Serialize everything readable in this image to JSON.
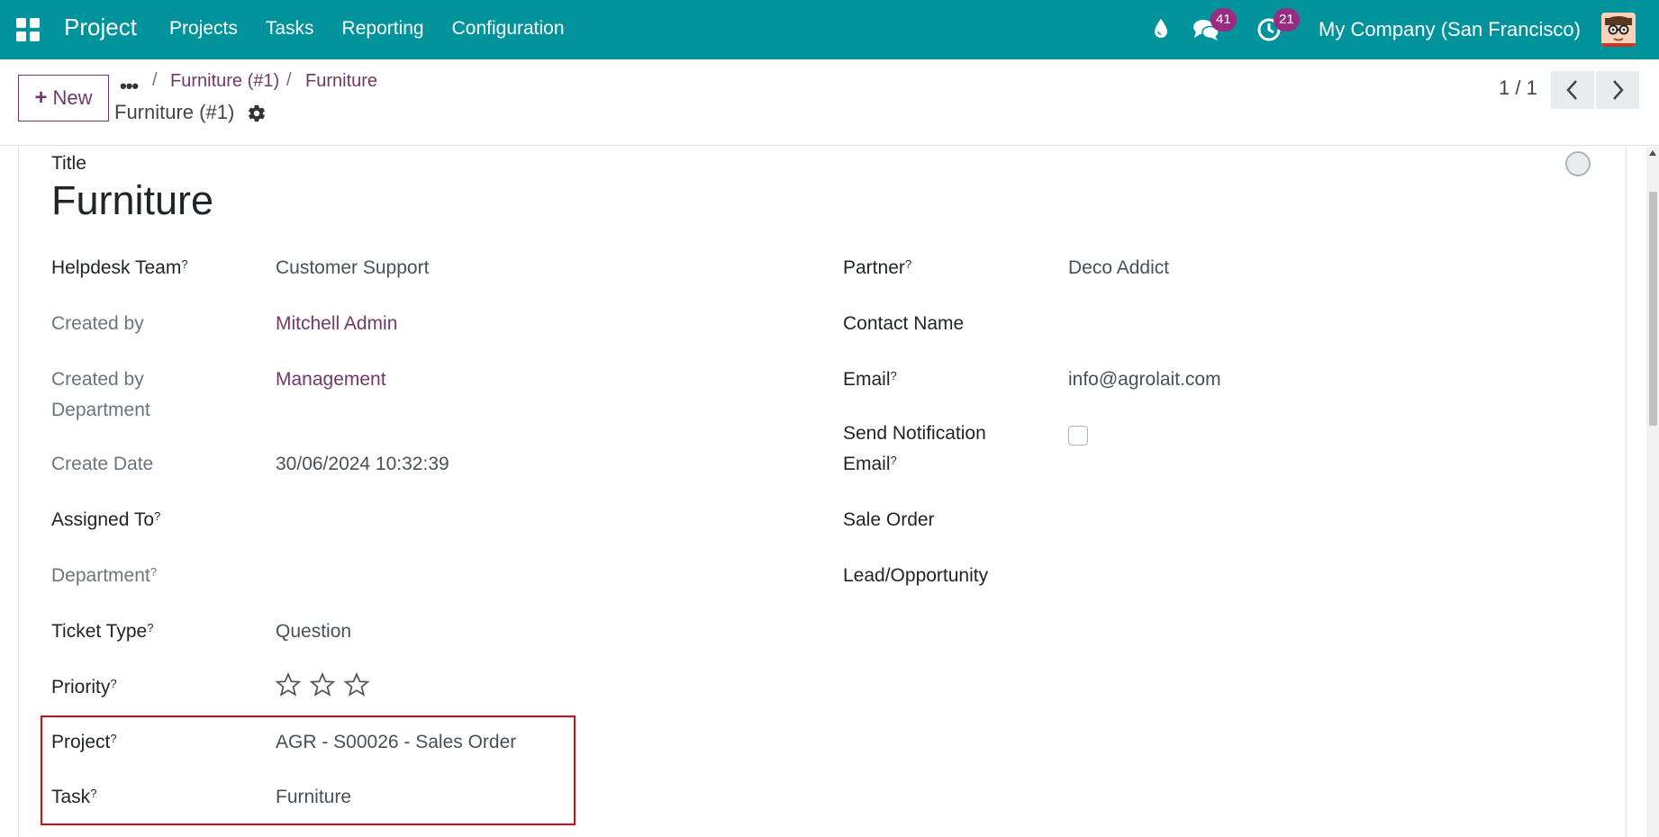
{
  "navbar": {
    "brand": "Project",
    "menu": [
      "Projects",
      "Tasks",
      "Reporting",
      "Configuration"
    ],
    "messages_count": "41",
    "activities_count": "21",
    "company": "My Company (San Francisco)",
    "color": "#00939b"
  },
  "control": {
    "new_label": "New",
    "breadcrumbs": [
      "Furniture (#1)",
      "Furniture"
    ],
    "record_title": "Furniture (#1)",
    "pager_value": "1 / 1"
  },
  "form": {
    "title_label": "Title",
    "title_value": "Furniture",
    "left": {
      "helpdesk_team": {
        "label": "Helpdesk Team",
        "value": "Customer Support"
      },
      "created_by": {
        "label": "Created by",
        "value": "Mitchell Admin"
      },
      "created_by_department": {
        "label_line1": "Created by",
        "label_line2": "Department",
        "value": "Management"
      },
      "create_date": {
        "label": "Create Date",
        "value": "30/06/2024 10:32:39"
      },
      "assigned_to": {
        "label": "Assigned To",
        "value": ""
      },
      "department": {
        "label": "Department",
        "value": ""
      },
      "ticket_type": {
        "label": "Ticket Type",
        "value": "Question"
      },
      "priority": {
        "label": "Priority",
        "stars": 0,
        "max_stars": 3
      },
      "project": {
        "label": "Project",
        "value": "AGR - S00026 - Sales Order"
      },
      "task": {
        "label": "Task",
        "value": "Furniture"
      }
    },
    "right": {
      "partner": {
        "label": "Partner",
        "value": "Deco Addict"
      },
      "contact_name": {
        "label": "Contact Name",
        "value": ""
      },
      "email": {
        "label": "Email",
        "value": "info@agrolait.com"
      },
      "send_notification": {
        "label_line1": "Send Notification",
        "label_line2": "Email",
        "checked": false
      },
      "sale_order": {
        "label": "Sale Order",
        "value": ""
      },
      "lead_opportunity": {
        "label": "Lead/Opportunity",
        "value": ""
      }
    },
    "help_marker": "?"
  },
  "colors": {
    "accent": "#71396a",
    "highlight_border": "#d00d14",
    "badge": "#9a2b83"
  }
}
